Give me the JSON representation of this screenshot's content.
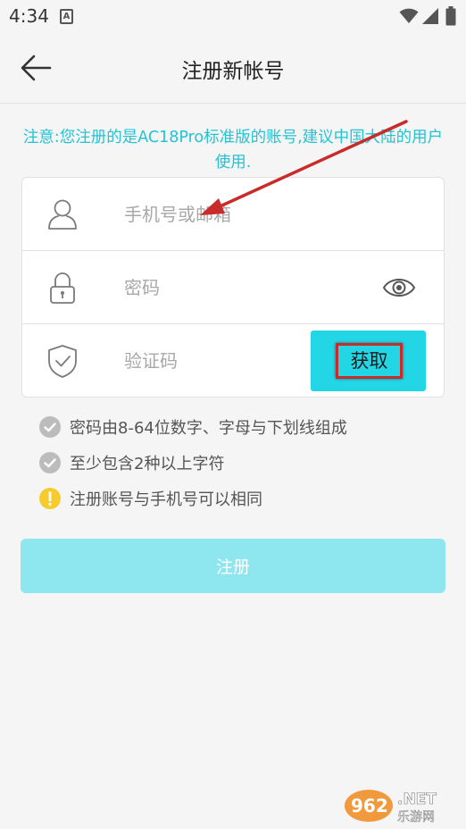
{
  "status_bar": {
    "time": "4:34",
    "notification_icon": "a-box-icon",
    "wifi_icon": "wifi-icon",
    "signal_icon": "signal-icon",
    "battery_icon": "battery-icon"
  },
  "header": {
    "back_icon": "arrow-left-icon",
    "title": "注册新帐号"
  },
  "notice": {
    "text": "注意:您注册的是AC18Pro标准版的账号,建议中国大陆的用户使用."
  },
  "form": {
    "account": {
      "icon": "user-icon",
      "placeholder": "手机号或邮箱",
      "value": ""
    },
    "password": {
      "icon": "lock-icon",
      "placeholder": "密码",
      "value": "",
      "toggle_icon": "eye-icon"
    },
    "code": {
      "icon": "shield-check-icon",
      "placeholder": "验证码",
      "value": "",
      "button_label": "获取"
    }
  },
  "rules": [
    {
      "icon": "check-circle-icon",
      "text": "密码由8-64位数字、字母与下划线组成"
    },
    {
      "icon": "check-circle-icon",
      "text": "至少包含2种以上字符"
    },
    {
      "icon": "warning-circle-icon",
      "text": "注册账号与手机号可以相同"
    }
  ],
  "submit": {
    "label": "注册"
  },
  "watermark": {
    "logo_text": "962.NET",
    "sub_text": "乐游网"
  },
  "colors": {
    "accent": "#22d6e6",
    "notice_text": "#22c4d4",
    "submit_disabled": "#8ee6ee",
    "annotation_red": "#c92a2a",
    "warning": "#f7cb2e"
  }
}
